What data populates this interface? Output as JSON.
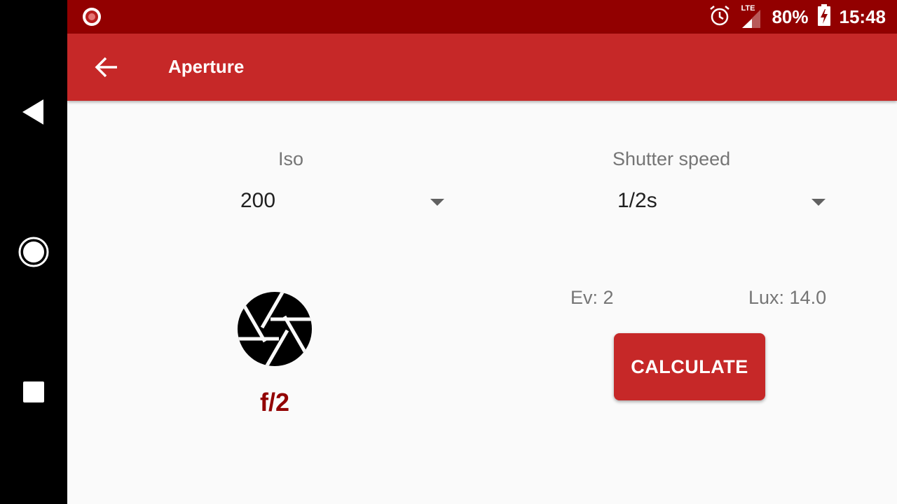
{
  "status": {
    "battery": "80%",
    "time": "15:48",
    "network": "LTE"
  },
  "appbar": {
    "title": "Aperture"
  },
  "iso": {
    "label": "Iso",
    "value": "200"
  },
  "shutter": {
    "label": "Shutter speed",
    "value": "1/2s"
  },
  "info": {
    "ev": "Ev: 2",
    "lux": "Lux: 14.0"
  },
  "calculate": {
    "label": "CALCULATE"
  },
  "result": {
    "value": "f/2"
  },
  "colors": {
    "status_bar": "#920000",
    "appbar": "#c62828",
    "accent": "#c62828",
    "result": "#920000"
  }
}
